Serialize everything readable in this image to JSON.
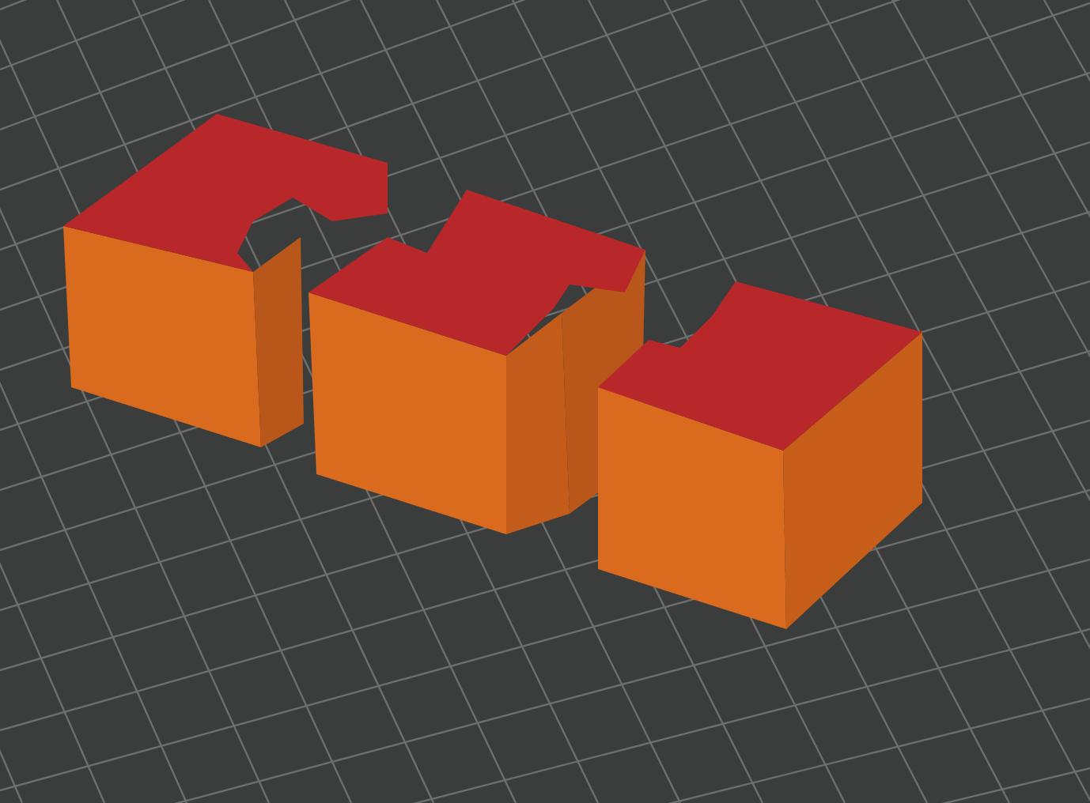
{
  "viewport": {
    "kind": "layer-preview"
  }
}
